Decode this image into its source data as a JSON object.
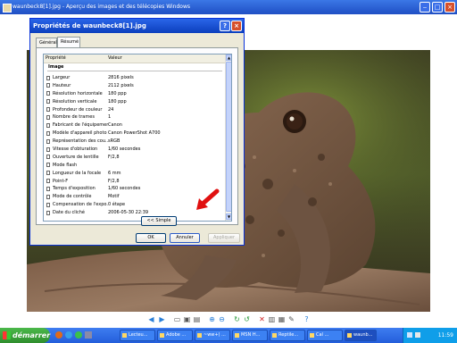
{
  "viewer": {
    "title": "waunbeck8[1].jpg - Aperçu des images et des télécopies Windows"
  },
  "dialog": {
    "title": "Propriétés de waunbeck8[1].jpg",
    "help": "?",
    "close": "×",
    "tabs": [
      {
        "label": "Général"
      },
      {
        "label": "Résumé"
      }
    ],
    "columns": {
      "property": "Propriété",
      "value": "Valeur"
    },
    "group": "Image",
    "rows": [
      {
        "property": "Largeur",
        "value": "2816 pixels"
      },
      {
        "property": "Hauteur",
        "value": "2112 pixels"
      },
      {
        "property": "Résolution horizontale",
        "value": "180 ppp"
      },
      {
        "property": "Résolution verticale",
        "value": "180 ppp"
      },
      {
        "property": "Profondeur de couleur",
        "value": "24"
      },
      {
        "property": "Nombre de trames",
        "value": "1"
      },
      {
        "property": "Fabricant de l'équipement",
        "value": "Canon"
      },
      {
        "property": "Modèle d'appareil photo",
        "value": "Canon PowerShot A700"
      },
      {
        "property": "Représentation des cou...",
        "value": "sRGB"
      },
      {
        "property": "Vitesse d'obturation",
        "value": "1/60 secondes"
      },
      {
        "property": "Ouverture de lentille",
        "value": "F/2,8"
      },
      {
        "property": "Mode flash",
        "value": ""
      },
      {
        "property": "Longueur de la focale",
        "value": "6 mm"
      },
      {
        "property": "Point-F",
        "value": "F/2,8"
      },
      {
        "property": "Temps d'exposition",
        "value": "1/60 secondes"
      },
      {
        "property": "Mode de contrôle",
        "value": "Motif"
      },
      {
        "property": "Compensation de l'expo...",
        "value": "0 étape"
      },
      {
        "property": "Date du cliché",
        "value": "2006-05-30 22:39"
      }
    ],
    "simple_button": "<< Simple",
    "ok_button": "OK",
    "cancel_button": "Annuler",
    "apply_button": "Appliquer"
  },
  "taskbar": {
    "start": "démarrer",
    "tasks": [
      {
        "label": "Lecteu..."
      },
      {
        "label": "Adobe ..."
      },
      {
        "label": "~ww+( ..."
      },
      {
        "label": "MSN H..."
      },
      {
        "label": "Reptile..."
      },
      {
        "label": "Cal ..."
      },
      {
        "label": "waunb..."
      }
    ],
    "clock": "11:59"
  },
  "colors": {
    "xp_blue": "#245edb",
    "start_green": "#3c9e3a",
    "annotation_arrow": "#e01010"
  }
}
